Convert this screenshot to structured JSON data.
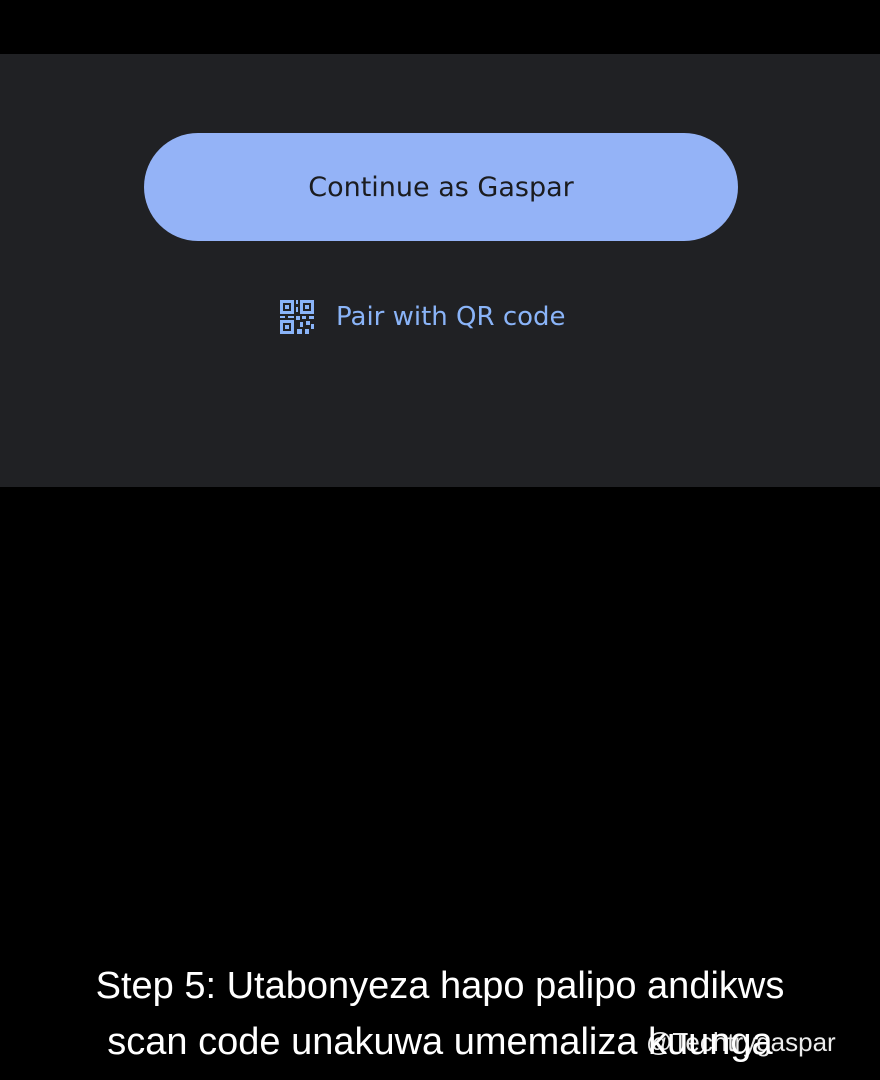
{
  "colors": {
    "panel_background": "#202124",
    "primary_button": "#94b3f7",
    "primary_button_text": "#1b1c1f",
    "link_text": "#8ab4f8",
    "caption_text": "#ffffff",
    "page_background": "#000000"
  },
  "sign_in": {
    "continue_label": "Continue as Gaspar",
    "pair_label": "Pair with QR code",
    "pair_icon": "qr-code-icon"
  },
  "caption": {
    "line1": "Step 5: Utabonyeza hapo palipo andikws",
    "line2": "scan code unakuwa umemaliza kuunga"
  },
  "watermark": {
    "text": "@Techtrygaspar"
  }
}
